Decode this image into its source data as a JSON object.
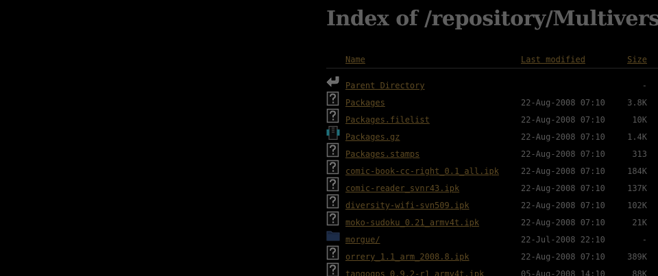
{
  "page": {
    "title": "Index of /repository/Multiverse"
  },
  "columns": {
    "name": "Name",
    "last_modified": "Last modified",
    "size": "Size"
  },
  "colors": {
    "background": "#000000",
    "link": "#5e4a22",
    "text": "#5a5a5a",
    "title": "#5f5f5f"
  },
  "entries": [
    {
      "icon": "back-icon",
      "name": "Parent Directory",
      "modified": "",
      "size": "-"
    },
    {
      "icon": "unknown-file-icon",
      "name": "Packages",
      "modified": "22-Aug-2008 07:10",
      "size": "3.8K"
    },
    {
      "icon": "unknown-file-icon",
      "name": "Packages.filelist",
      "modified": "22-Aug-2008 07:10",
      "size": "10K"
    },
    {
      "icon": "compressed-file-icon",
      "name": "Packages.gz",
      "modified": "22-Aug-2008 07:10",
      "size": "1.4K"
    },
    {
      "icon": "unknown-file-icon",
      "name": "Packages.stamps",
      "modified": "22-Aug-2008 07:10",
      "size": "313"
    },
    {
      "icon": "unknown-file-icon",
      "name": "comic-book-cc-right_0.1_all.ipk",
      "modified": "22-Aug-2008 07:10",
      "size": "184K"
    },
    {
      "icon": "unknown-file-icon",
      "name": "comic-reader_svnr43.ipk",
      "modified": "22-Aug-2008 07:10",
      "size": "137K"
    },
    {
      "icon": "unknown-file-icon",
      "name": "diversity-wifi-svn509.ipk",
      "modified": "22-Aug-2008 07:10",
      "size": "102K"
    },
    {
      "icon": "unknown-file-icon",
      "name": "moko-sudoku_0.21_armv4t.ipk",
      "modified": "22-Aug-2008 07:10",
      "size": "21K"
    },
    {
      "icon": "folder-icon",
      "name": "morgue/",
      "modified": "22-Jul-2008 22:10",
      "size": "-"
    },
    {
      "icon": "unknown-file-icon",
      "name": "orrery_1.1_arm_2008.8.ipk",
      "modified": "22-Aug-2008 07:10",
      "size": "389K"
    },
    {
      "icon": "unknown-file-icon",
      "name": "tangogps_0.9.2-r1_armv4t.ipk",
      "modified": "05-Aug-2008 14:10",
      "size": "88K"
    }
  ]
}
